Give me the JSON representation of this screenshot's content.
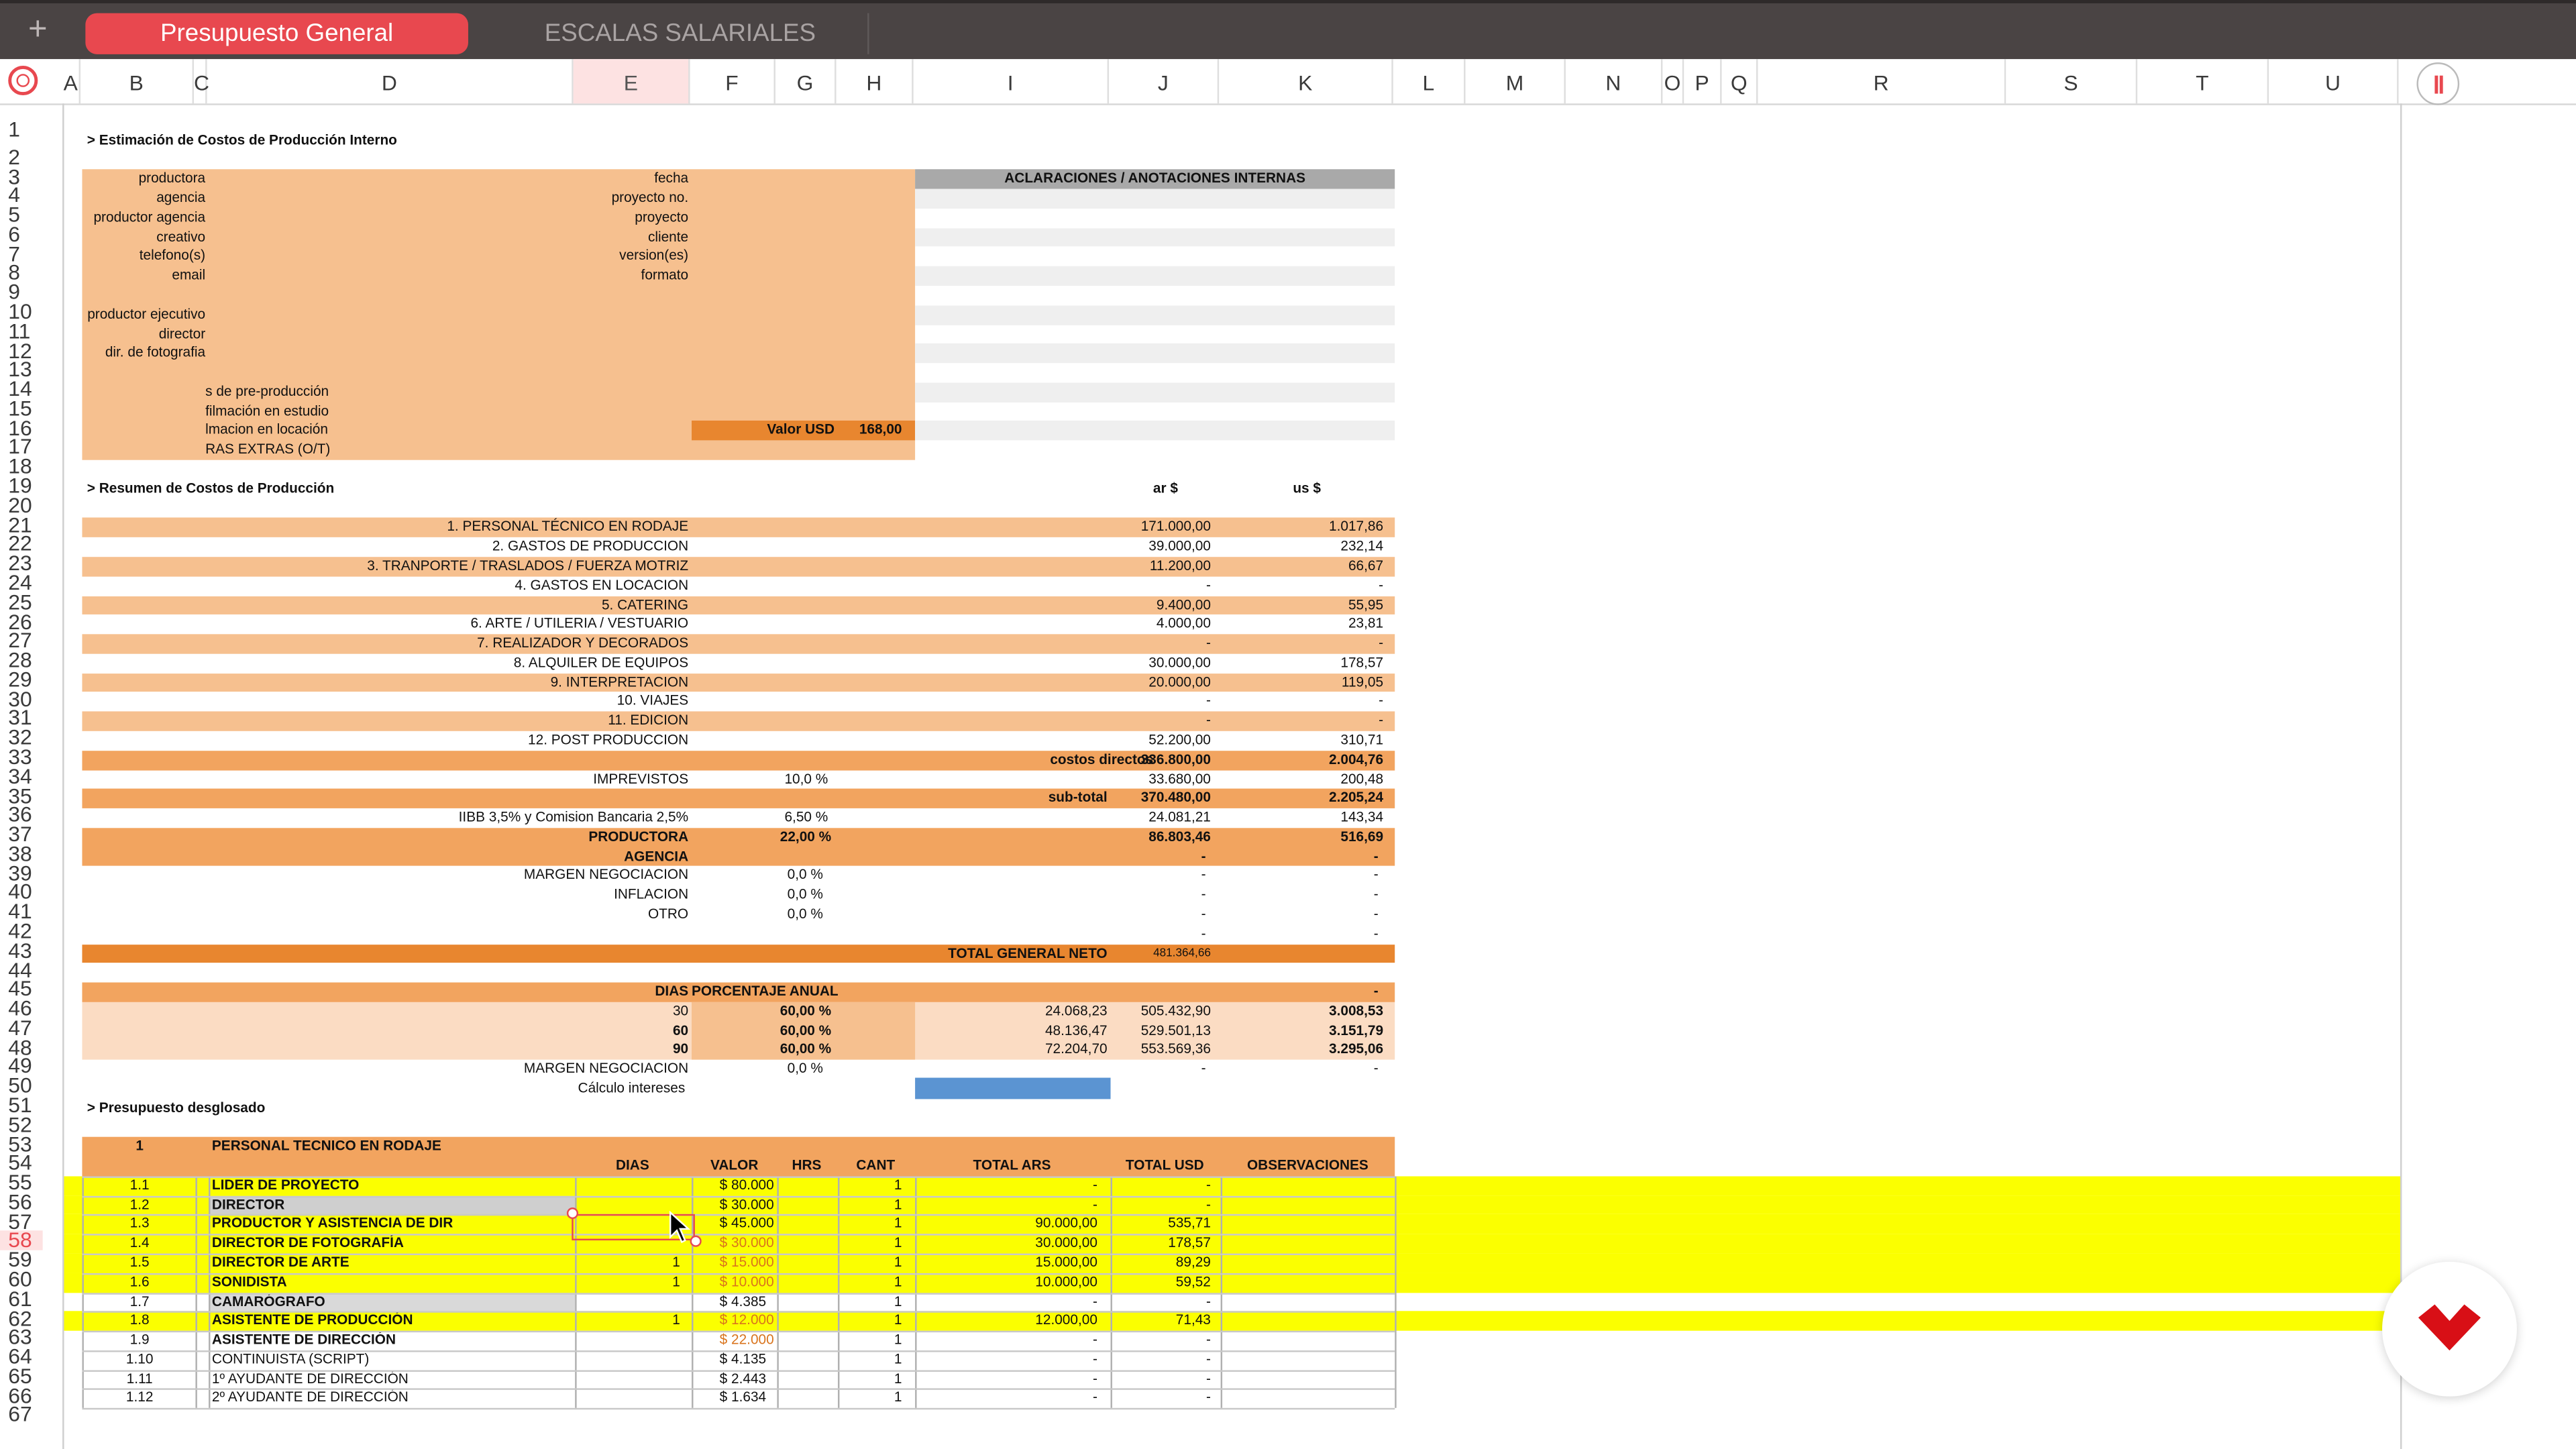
{
  "tabs": {
    "add_label": "+",
    "active": "Presupuesto General",
    "inactive": "ESCALAS SALARIALES"
  },
  "columns": [
    "A",
    "B",
    "C",
    "D",
    "E",
    "F",
    "G",
    "H",
    "I",
    "J",
    "K",
    "L",
    "M",
    "N",
    "O",
    "P",
    "Q",
    "R",
    "S",
    "T",
    "U"
  ],
  "rows": [
    "1",
    "2",
    "3",
    "4",
    "5",
    "6",
    "7",
    "8",
    "9",
    "10",
    "11",
    "12",
    "13",
    "14",
    "15",
    "16",
    "17",
    "18",
    "19",
    "20",
    "21",
    "22",
    "23",
    "24",
    "25",
    "26",
    "27",
    "28",
    "29",
    "30",
    "31",
    "32",
    "33",
    "34",
    "35",
    "36",
    "37",
    "38",
    "39",
    "40",
    "41",
    "42",
    "43",
    "44",
    "45",
    "46",
    "47",
    "48",
    "49",
    "50",
    "51",
    "52",
    "53",
    "54",
    "55",
    "56",
    "57",
    "58",
    "59",
    "60",
    "61",
    "62",
    "63",
    "64",
    "65",
    "66",
    "67"
  ],
  "colors": {
    "accent": "#e8484f",
    "orange_light": "#f6c08f",
    "orange_mid": "#f2a45f",
    "orange_dark": "#e8862f",
    "peach": "#fbdcc3",
    "yellow": "#fbff00",
    "gray_header": "#a9a9a9",
    "gray_band": "#efefef",
    "blue_bar": "#5b94d2"
  },
  "info": {
    "title": "> Estimación de Costos de Producción Interno",
    "labels_left": [
      "productora",
      "agencia",
      "productor agencia",
      "creativo",
      "telefono(s)",
      "email",
      "productor ejecutivo",
      "director",
      "dir. de fotografia",
      "s de pre-producción",
      "filmación en estudio",
      "lmacion en locación",
      "RAS EXTRAS (O/T)"
    ],
    "labels_right": [
      "fecha",
      "proyecto no.",
      "proyecto",
      "cliente",
      "version(es)",
      "formato"
    ],
    "valor_usd_label": "Valor USD",
    "valor_usd": "168,00",
    "notes_header": "ACLARACIONES / ANOTACIONES INTERNAS"
  },
  "summary": {
    "title": "> Resumen de Costos de Producción",
    "col_ars": "ar $",
    "col_usd": "us $",
    "items": [
      {
        "label": "1. PERSONAL TÉCNICO EN RODAJE",
        "ars": "171.000,00",
        "usd": "1.017,86"
      },
      {
        "label": "2. GASTOS DE PRODUCCION",
        "ars": "39.000,00",
        "usd": "232,14"
      },
      {
        "label": "3. TRANPORTE / TRASLADOS / FUERZA MOTRIZ",
        "ars": "11.200,00",
        "usd": "66,67"
      },
      {
        "label": "4. GASTOS EN  LOCACION",
        "ars": "-",
        "usd": "-"
      },
      {
        "label": "5. CATERING",
        "ars": "9.400,00",
        "usd": "55,95"
      },
      {
        "label": "6. ARTE / UTILERIA / VESTUARIO",
        "ars": "4.000,00",
        "usd": "23,81"
      },
      {
        "label": "7. REALIZADOR Y DECORADOS",
        "ars": "-",
        "usd": "-"
      },
      {
        "label": "8. ALQUILER DE EQUIPOS",
        "ars": "30.000,00",
        "usd": "178,57"
      },
      {
        "label": "9. INTERPRETACION",
        "ars": "20.000,00",
        "usd": "119,05"
      },
      {
        "label": "10. VIAJES",
        "ars": "-",
        "usd": "-"
      },
      {
        "label": "11. EDICION",
        "ars": "-",
        "usd": "-"
      },
      {
        "label": "12. POST PRODUCCION",
        "ars": "52.200,00",
        "usd": "310,71"
      }
    ],
    "costos_directos": {
      "label": "costos directos",
      "ars": "336.800,00",
      "usd": "2.004,76"
    },
    "imprevistos": {
      "label": "IMPREVISTOS",
      "pct": "10,0 %",
      "ars": "33.680,00",
      "usd": "200,48"
    },
    "subtotal": {
      "label": "sub-total",
      "ars": "370.480,00",
      "usd": "2.205,24"
    },
    "iibb": {
      "label": "IIBB 3,5% y Comision Bancaria 2,5%",
      "pct": "6,50 %",
      "ars": "24.081,21",
      "usd": "143,34"
    },
    "productora": {
      "label": "PRODUCTORA",
      "pct": "22,00 %",
      "ars": "86.803,46",
      "usd": "516,69"
    },
    "agencia": {
      "label": "AGENCIA",
      "ars": "-",
      "usd": "-"
    },
    "margen": {
      "label": "MARGEN NEGOCIACION",
      "pct": "0,0 %",
      "ars": "-",
      "usd": "-"
    },
    "inflacion": {
      "label": "INFLACION",
      "pct": "0,0 %",
      "ars": "-",
      "usd": "-"
    },
    "otro": {
      "label": "OTRO",
      "pct": "0,0 %",
      "ars": "-",
      "usd": "-"
    },
    "row43_ars": "-",
    "row43_usd": "-",
    "total_label": "TOTAL GENERAL NETO",
    "total_value": "481.364,66"
  },
  "interest": {
    "hdr_dias": "DIAS",
    "hdr_pct": "PORCENTAJE ANUAL",
    "hdr_usd": "-",
    "rows": [
      {
        "dias": "30",
        "pct": "60,00 %",
        "interes": "24.068,23",
        "total_ars": "505.432,90",
        "total_usd": "3.008,53"
      },
      {
        "dias": "60",
        "pct": "60,00 %",
        "interes": "48.136,47",
        "total_ars": "529.501,13",
        "total_usd": "3.151,79"
      },
      {
        "dias": "90",
        "pct": "60,00 %",
        "interes": "72.204,70",
        "total_ars": "553.569,36",
        "total_usd": "3.295,06"
      }
    ],
    "margen": {
      "label": "MARGEN NEGOCIACION",
      "pct": "0,0 %",
      "ars": "-",
      "usd": "-"
    },
    "calculo": "Cálculo intereses"
  },
  "breakdown": {
    "title": "> Presupuesto desglosado",
    "section_num": "1",
    "section_label": "PERSONAL TECNICO EN RODAJE",
    "headers": {
      "dias": "DIAS",
      "valor": "VALOR",
      "hrs": "HRS",
      "cant": "CANT",
      "total_ars": "TOTAL ARS",
      "total_usd": "TOTAL USD",
      "obs": "OBSERVACIONES"
    },
    "items": [
      {
        "num": "1.1",
        "name": "LIDER DE PROYECTO",
        "dias": "",
        "valor": "$ 80.000",
        "cant": "1",
        "ars": "-",
        "usd": "-"
      },
      {
        "num": "1.2",
        "name": "DIRECTOR",
        "dias": "",
        "valor": "$ 30.000",
        "cant": "1",
        "ars": "-",
        "usd": "-"
      },
      {
        "num": "1.3",
        "name": "PRODUCTOR Y ASISTENCIA DE DIR",
        "dias": "",
        "valor": "$ 45.000",
        "cant": "1",
        "ars": "90.000,00",
        "usd": "535,71"
      },
      {
        "num": "1.4",
        "name": "DIRECTOR DE FOTOGRAFÍA",
        "dias": "",
        "valor": "$ 30.000",
        "cant": "1",
        "ars": "30.000,00",
        "usd": "178,57"
      },
      {
        "num": "1.5",
        "name": "DIRECTOR DE ARTE",
        "dias": "1",
        "valor": "$ 15.000",
        "cant": "1",
        "ars": "15.000,00",
        "usd": "89,29"
      },
      {
        "num": "1.6",
        "name": "SONIDISTA",
        "dias": "1",
        "valor": "$ 10.000",
        "cant": "1",
        "ars": "10.000,00",
        "usd": "59,52"
      },
      {
        "num": "1.7",
        "name": "CAMARÓGRAFO",
        "dias": "",
        "valor": "$ 4.385",
        "cant": "1",
        "ars": "-",
        "usd": "-"
      },
      {
        "num": "1.8",
        "name": "ASISTENTE DE PRODUCCIÓN",
        "dias": "1",
        "valor": "$ 12.000",
        "cant": "1",
        "ars": "12.000,00",
        "usd": "71,43"
      },
      {
        "num": "1.9",
        "name": "ASISTENTE DE DIRECCIÓN",
        "dias": "",
        "valor": "$ 22.000",
        "cant": "1",
        "ars": "-",
        "usd": "-"
      },
      {
        "num": "1.10",
        "name": "CONTINUISTA (SCRIPT)",
        "dias": "",
        "valor": "$ 4.135",
        "cant": "1",
        "ars": "-",
        "usd": "-"
      },
      {
        "num": "1.11",
        "name": "1º AYUDANTE DE DIRECCIÓN",
        "dias": "",
        "valor": "$ 2.443",
        "cant": "1",
        "ars": "-",
        "usd": "-"
      },
      {
        "num": "1.12",
        "name": "2º AYUDANTE DE DIRECCIÓN",
        "dias": "",
        "valor": "$ 1.634",
        "cant": "1",
        "ars": "-",
        "usd": "-"
      }
    ]
  }
}
